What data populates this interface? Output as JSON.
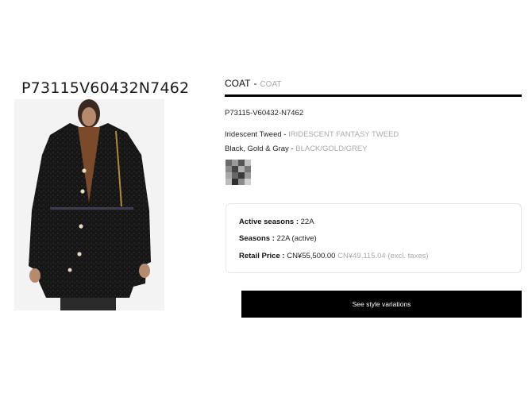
{
  "product": {
    "sku_heading": "P73115V60432N7462",
    "image_alt": "Black tweed coat with gold buttons"
  },
  "details": {
    "category": "COAT",
    "separator": "-",
    "category_sub": "COAT",
    "reference": "P73115-V60432-N7462",
    "material_label": "Iridescent Tweed -",
    "material_value": "IRIDESCENT FANTASY TWEED",
    "color_label": "Black, Gold & Gray -",
    "color_value": "BLACK/GOLD/GREY"
  },
  "info": {
    "active_seasons_label": "Active seasons :",
    "active_seasons_value": "22A",
    "seasons_label": "Seasons :",
    "seasons_value": "22A (active)",
    "retail_price_label": "Retail Price :",
    "retail_price_value": "CN¥55,500.00",
    "retail_price_excl": "CN¥49,115.04 (excl. taxes)"
  },
  "actions": {
    "style_variations_label": "See style variations"
  },
  "colors": {
    "accent": "#000000",
    "muted_text": "#aaaaaa"
  }
}
